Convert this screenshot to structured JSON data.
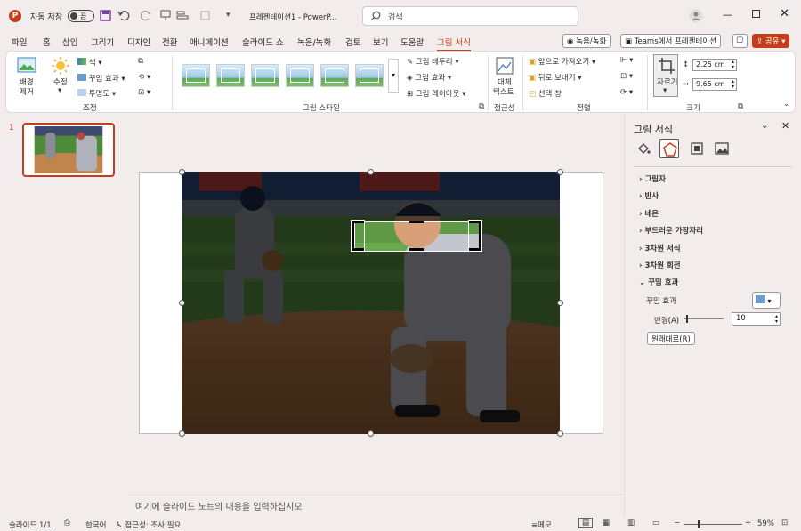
{
  "titlebar": {
    "autosave_label": "자동 저장",
    "toggle_state": "끔",
    "doc_title": "프레젠테이션1  -  PowerP...",
    "search_placeholder": "검색"
  },
  "tabs": [
    "파일",
    "홈",
    "삽입",
    "그리기",
    "디자인",
    "전환",
    "애니메이션",
    "슬라이드 쇼",
    "녹음/녹화",
    "검토",
    "보기",
    "도움말",
    "그림 서식"
  ],
  "active_tab": "그림 서식",
  "top_buttons": {
    "record": "녹음/녹화",
    "teams": "Teams에서 프레젠테이션",
    "share": "공유"
  },
  "ribbon": {
    "remove_bg": [
      "배경",
      "제거"
    ],
    "corrections": "수정",
    "color": "색",
    "artistic": "꾸밈 효과",
    "transparency": "투명도",
    "group_adjust": "조정",
    "group_styles": "그림 스타일",
    "border": "그림 테두리",
    "effects": "그림 효과",
    "layout": "그림 레이아웃",
    "alt_text": [
      "대체",
      "텍스트"
    ],
    "group_access": "접근성",
    "bring_forward": "앞으로 가져오기",
    "send_backward": "뒤로 보내기",
    "selection_pane": "선택 창",
    "group_arrange": "정렬",
    "crop": "자르기",
    "height": "2.25 cm",
    "width": "9.65 cm",
    "group_size": "크기"
  },
  "slide_number": "1",
  "notes_placeholder": "여기에 슬라이드 노트의 내용을 입력하십시오",
  "pane": {
    "title": "그림 서식",
    "sections": [
      "그림자",
      "반사",
      "네온",
      "부드러운 가장자리",
      "3차원 서식",
      "3차원 회전"
    ],
    "open_section": "꾸밈 효과",
    "effect_label": "꾸밈 효과",
    "radius_label": "반경(A)",
    "radius_value": "10",
    "reset_label": "원래대로(R)"
  },
  "status": {
    "slide": "슬라이드 1/1",
    "language": "한국어",
    "accessibility": "접근성: 조사 필요",
    "notes": "메모",
    "zoom": "59%"
  },
  "colors": {
    "accent": "#c43e1c",
    "dim_overlay": "rgba(0,0,0,0.62)"
  }
}
